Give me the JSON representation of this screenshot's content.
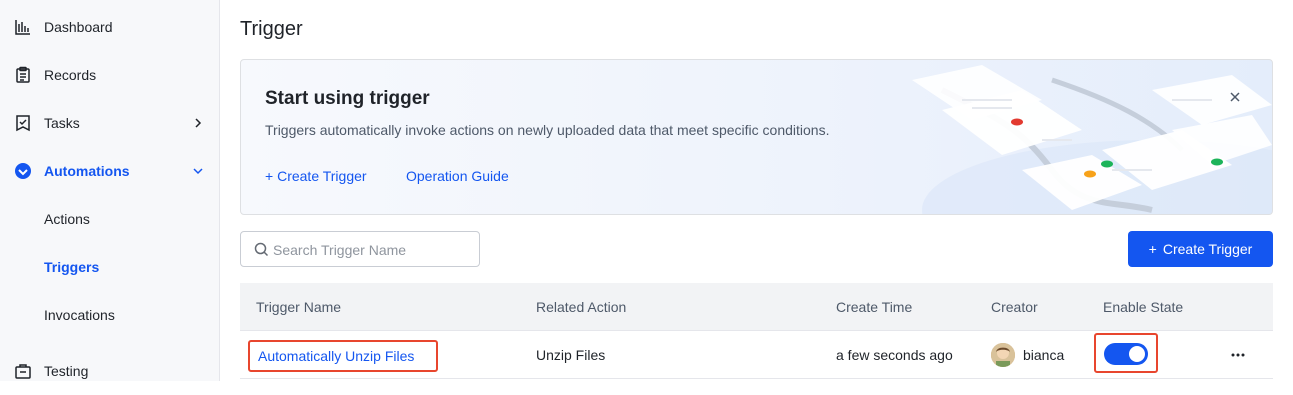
{
  "sidebar": {
    "items": [
      {
        "label": "Dashboard",
        "icon": "bar-chart-icon"
      },
      {
        "label": "Records",
        "icon": "clipboard-icon"
      },
      {
        "label": "Tasks",
        "icon": "task-icon"
      },
      {
        "label": "Automations",
        "icon": "automation-icon"
      },
      {
        "label": "Actions"
      },
      {
        "label": "Triggers"
      },
      {
        "label": "Invocations"
      },
      {
        "label": "Testing",
        "icon": "testing-icon"
      }
    ]
  },
  "page": {
    "title": "Trigger"
  },
  "banner": {
    "title": "Start using trigger",
    "description": "Triggers automatically invoke actions on newly uploaded data that meet specific conditions.",
    "create_link": "Create Trigger",
    "guide_link": "Operation Guide"
  },
  "search": {
    "placeholder": "Search Trigger Name",
    "value": ""
  },
  "toolbar": {
    "create_label": "Create Trigger"
  },
  "table": {
    "headers": [
      "Trigger Name",
      "Related Action",
      "Create Time",
      "Creator",
      "Enable State"
    ],
    "rows": [
      {
        "name": "Automatically Unzip Files",
        "action": "Unzip Files",
        "time": "a few seconds ago",
        "creator": "bianca",
        "enabled": true
      }
    ]
  },
  "colors": {
    "accent": "#1456f0",
    "highlight": "#e8462e"
  }
}
